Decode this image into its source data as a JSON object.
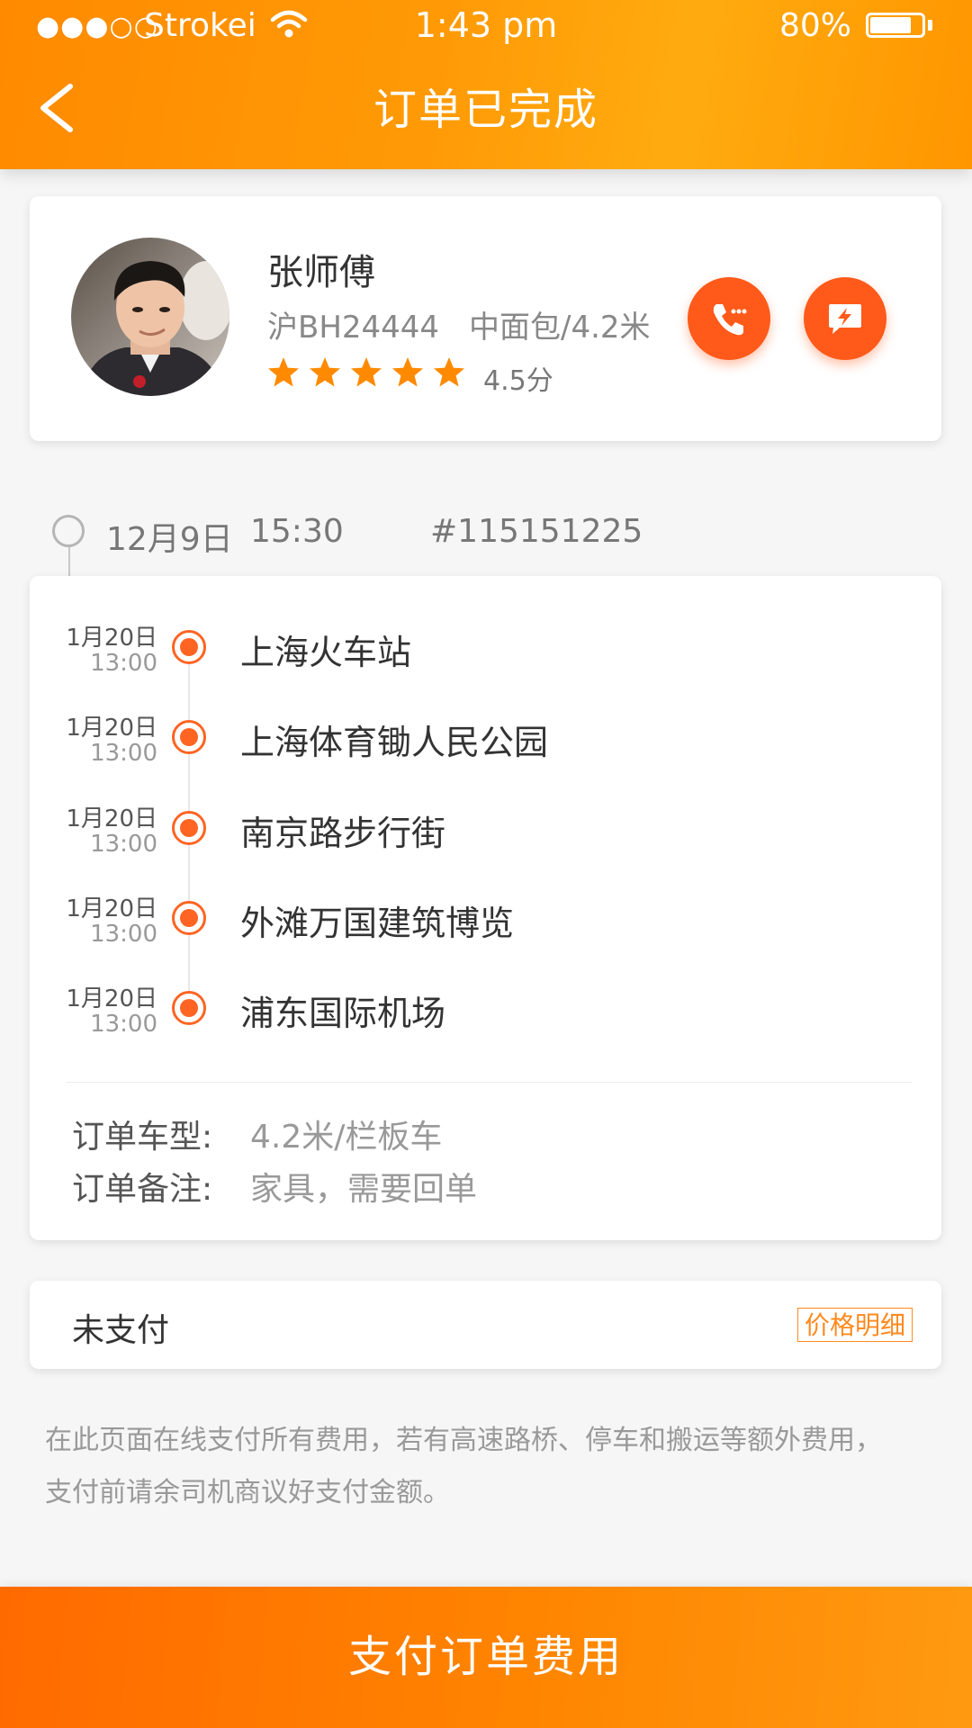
{
  "status_bar": {
    "signal": "●●●○○",
    "carrier": "Strokei",
    "time": "1:43 pm",
    "battery_percent": "80%",
    "battery_level": 0.8
  },
  "nav": {
    "back_icon": "chevron-left-icon",
    "title": "订单已完成"
  },
  "driver": {
    "name": "张师傅",
    "plate": "沪BH24444",
    "vehicle": "中面包/4.2米",
    "stars_filled": 5,
    "rating": "4.5分",
    "call_icon": "phone-icon",
    "message_icon": "message-icon",
    "accent_color": "#ff5a1a"
  },
  "order": {
    "date": "12月9日",
    "time": "15:30",
    "number": "#115151225"
  },
  "route": {
    "stops": [
      {
        "date": "1月20日",
        "time": "13:00",
        "name": "上海火车站"
      },
      {
        "date": "1月20日",
        "time": "13:00",
        "name": "上海体育锄人民公园"
      },
      {
        "date": "1月20日",
        "time": "13:00",
        "name": "南京路步行街"
      },
      {
        "date": "1月20日",
        "time": "13:00",
        "name": "外滩万国建筑博览"
      },
      {
        "date": "1月20日",
        "time": "13:00",
        "name": "浦东国际机场"
      }
    ],
    "vehicle_type_label": "订单车型:",
    "vehicle_type_value": "4.2米/栏板车",
    "remark_label": "订单备注:",
    "remark_value": "家具，需要回单"
  },
  "payment": {
    "status": "未支付",
    "price_detail_label": "价格明细"
  },
  "notice": {
    "line1": "在此页面在线支付所有费用，若有高速路桥、停车和搬运等额外费用，",
    "line2": "支付前请余司机商议好支付金额。"
  },
  "footer": {
    "pay_button_label": "支付订单费用",
    "brand_color": "#ff7a00"
  }
}
